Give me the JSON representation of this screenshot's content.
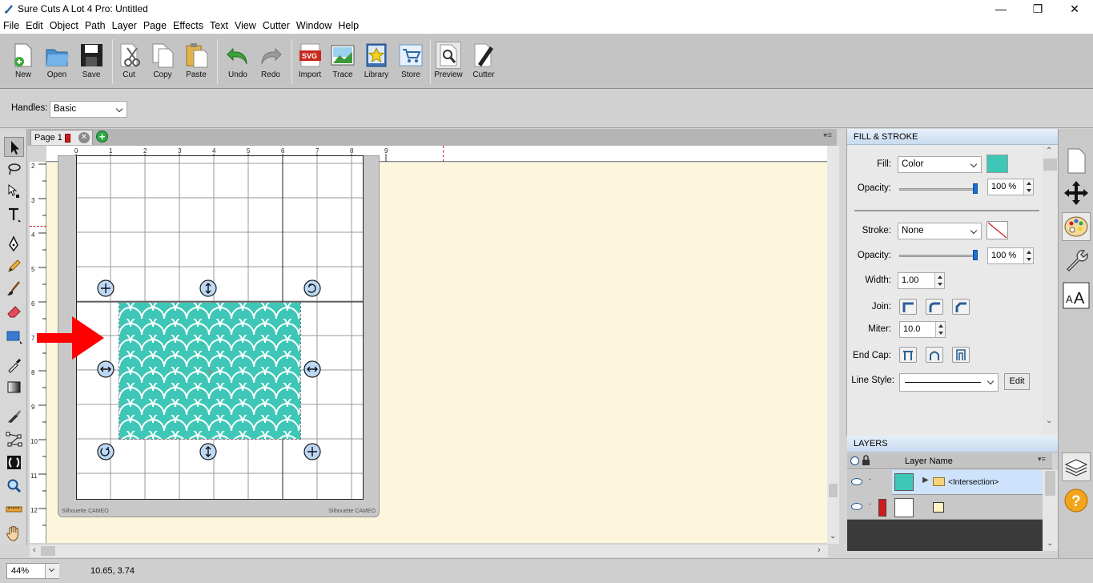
{
  "window": {
    "title": "Sure Cuts A Lot 4 Pro: Untitled",
    "controls": {
      "minimize": "—",
      "maximize": "❐",
      "close": "✕"
    }
  },
  "menu": [
    "File",
    "Edit",
    "Object",
    "Path",
    "Layer",
    "Page",
    "Effects",
    "Text",
    "View",
    "Cutter",
    "Window",
    "Help"
  ],
  "toolbar": {
    "buttons": [
      {
        "label": "New",
        "icon": "new-document-icon"
      },
      {
        "label": "Open",
        "icon": "open-folder-icon"
      },
      {
        "label": "Save",
        "icon": "save-disk-icon"
      },
      {
        "label": "Cut",
        "icon": "scissors-icon"
      },
      {
        "label": "Copy",
        "icon": "copy-icon"
      },
      {
        "label": "Paste",
        "icon": "paste-icon"
      },
      {
        "label": "Undo",
        "icon": "undo-icon"
      },
      {
        "label": "Redo",
        "icon": "redo-icon"
      },
      {
        "label": "Import",
        "icon": "svg-import-icon"
      },
      {
        "label": "Trace",
        "icon": "trace-image-icon"
      },
      {
        "label": "Library",
        "icon": "library-star-icon"
      },
      {
        "label": "Store",
        "icon": "store-cart-icon"
      },
      {
        "label": "Preview",
        "icon": "preview-magnifier-icon"
      },
      {
        "label": "Cutter",
        "icon": "cutter-pen-icon"
      }
    ]
  },
  "handles": {
    "label": "Handles:",
    "value": "Basic"
  },
  "page_tab": {
    "label": "Page 1"
  },
  "ruler": {
    "top": [
      "0",
      "1",
      "2",
      "3",
      "4",
      "5",
      "6",
      "7",
      "8",
      "9"
    ],
    "left": [
      "2",
      "3",
      "4",
      "5",
      "6",
      "7",
      "8",
      "9",
      "10",
      "11",
      "12"
    ]
  },
  "mat": {
    "label_left": "Silhouette CAMEO",
    "label_right": "Silhouette CAMEO"
  },
  "status": {
    "zoom": "44%",
    "coords": "10.65, 3.74"
  },
  "fill_stroke": {
    "title": "FILL & STROKE",
    "fill_label": "Fill:",
    "fill_value": "Color",
    "fill_color": "#3ec7b6",
    "fill_opacity_label": "Opacity:",
    "fill_opacity": "100 %",
    "stroke_label": "Stroke:",
    "stroke_value": "None",
    "stroke_opacity_label": "Opacity:",
    "stroke_opacity": "100 %",
    "width_label": "Width:",
    "width_value": "1.00",
    "join_label": "Join:",
    "miter_label": "Miter:",
    "miter_value": "10.0",
    "endcap_label": "End Cap:",
    "linestyle_label": "Line Style:",
    "edit_label": "Edit"
  },
  "layers": {
    "title": "LAYERS",
    "column_name": "Layer Name",
    "rows": [
      {
        "name": "<Intersection>",
        "selected": true
      },
      {
        "name": "",
        "selected": false
      }
    ]
  },
  "colors": {
    "accent": "#3ec7b6",
    "selection": "#cde3fb",
    "arrow": "#ff0000"
  }
}
